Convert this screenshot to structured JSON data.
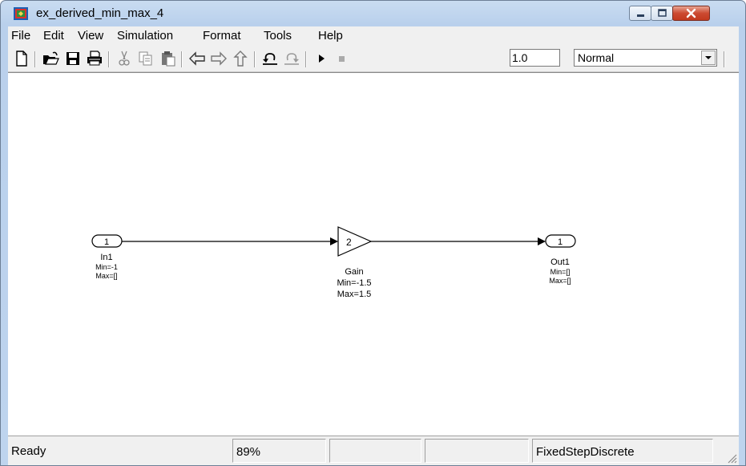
{
  "window": {
    "title": "ex_derived_min_max_4"
  },
  "menu": [
    "File",
    "Edit",
    "View",
    "Simulation",
    "Format",
    "Tools",
    "Help"
  ],
  "toolbar": {
    "stop_time": "1.0",
    "sim_mode": "Normal",
    "icons": [
      "new-model-icon",
      "open-icon",
      "save-icon",
      "print-icon",
      "cut-icon",
      "copy-icon",
      "paste-icon",
      "back-icon",
      "forward-icon",
      "up-icon",
      "undo-icon",
      "redo-icon",
      "run-icon",
      "stop-icon"
    ]
  },
  "diagram": {
    "inport": {
      "number": "1",
      "name": "In1",
      "min": "Min=-1",
      "max": "Max=[]"
    },
    "gain": {
      "value": "2",
      "name": "Gain",
      "min": "Min=-1.5",
      "max": "Max=1.5"
    },
    "outport": {
      "number": "1",
      "name": "Out1",
      "min": "Min=[]",
      "max": "Max=[]"
    }
  },
  "status": {
    "state": "Ready",
    "zoom": "89%",
    "solver": "FixedStepDiscrete"
  }
}
